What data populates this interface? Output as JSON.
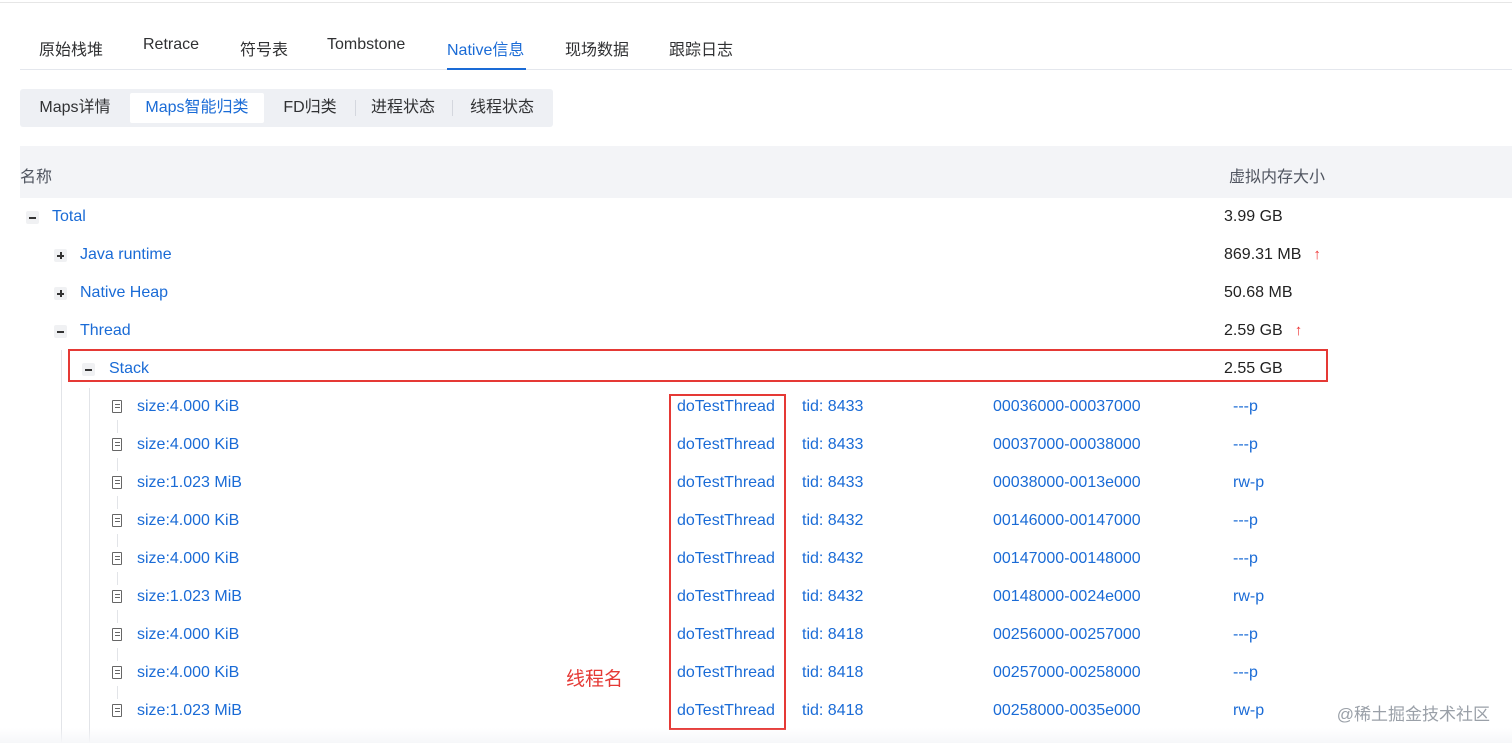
{
  "main_tabs": [
    {
      "label": "原始栈堆"
    },
    {
      "label": "Retrace"
    },
    {
      "label": "符号表"
    },
    {
      "label": "Tombstone"
    },
    {
      "label": "Native信息",
      "active": true
    },
    {
      "label": "现场数据"
    },
    {
      "label": "跟踪日志"
    }
  ],
  "sub_tabs": [
    {
      "label": "Maps详情"
    },
    {
      "label": "Maps智能归类",
      "active": true
    },
    {
      "label": "FD归类"
    },
    {
      "label": "进程状态"
    },
    {
      "label": "线程状态"
    }
  ],
  "table": {
    "headers": {
      "name": "名称",
      "size": "虚拟内存大小"
    },
    "groups": [
      {
        "name": "Total",
        "size": "3.99 GB",
        "expanded": true
      },
      {
        "name": "Java runtime",
        "size": "869.31 MB",
        "trend": "↑",
        "expanded": false
      },
      {
        "name": "Native Heap",
        "size": "50.68 MB",
        "expanded": false
      },
      {
        "name": "Thread",
        "size": "2.59 GB",
        "trend": "↑",
        "expanded": true
      },
      {
        "name": "Stack",
        "size": "2.55 GB",
        "expanded": true
      }
    ],
    "entries": [
      {
        "size": "size:4.000 KiB",
        "thread": "doTestThread",
        "tid": "tid: 8433",
        "range": "00036000-00037000",
        "perm": "---p"
      },
      {
        "size": "size:4.000 KiB",
        "thread": "doTestThread",
        "tid": "tid: 8433",
        "range": "00037000-00038000",
        "perm": "---p"
      },
      {
        "size": "size:1.023 MiB",
        "thread": "doTestThread",
        "tid": "tid: 8433",
        "range": "00038000-0013e000",
        "perm": "rw-p"
      },
      {
        "size": "size:4.000 KiB",
        "thread": "doTestThread",
        "tid": "tid: 8432",
        "range": "00146000-00147000",
        "perm": "---p"
      },
      {
        "size": "size:4.000 KiB",
        "thread": "doTestThread",
        "tid": "tid: 8432",
        "range": "00147000-00148000",
        "perm": "---p"
      },
      {
        "size": "size:1.023 MiB",
        "thread": "doTestThread",
        "tid": "tid: 8432",
        "range": "00148000-0024e000",
        "perm": "rw-p"
      },
      {
        "size": "size:4.000 KiB",
        "thread": "doTestThread",
        "tid": "tid: 8418",
        "range": "00256000-00257000",
        "perm": "---p"
      },
      {
        "size": "size:4.000 KiB",
        "thread": "doTestThread",
        "tid": "tid: 8418",
        "range": "00257000-00258000",
        "perm": "---p"
      },
      {
        "size": "size:1.023 MiB",
        "thread": "doTestThread",
        "tid": "tid: 8418",
        "range": "00258000-0035e000",
        "perm": "rw-p"
      }
    ]
  },
  "annotation": "线程名",
  "watermark": "@稀土掘金技术社区",
  "colors": {
    "link": "#1a6bd6",
    "highlight": "#e53935",
    "trend_up": "#e33"
  },
  "icons": {
    "collapse": "minus-square-icon",
    "expand": "plus-square-icon",
    "entry": "file-icon",
    "trend": "arrow-up-icon"
  }
}
